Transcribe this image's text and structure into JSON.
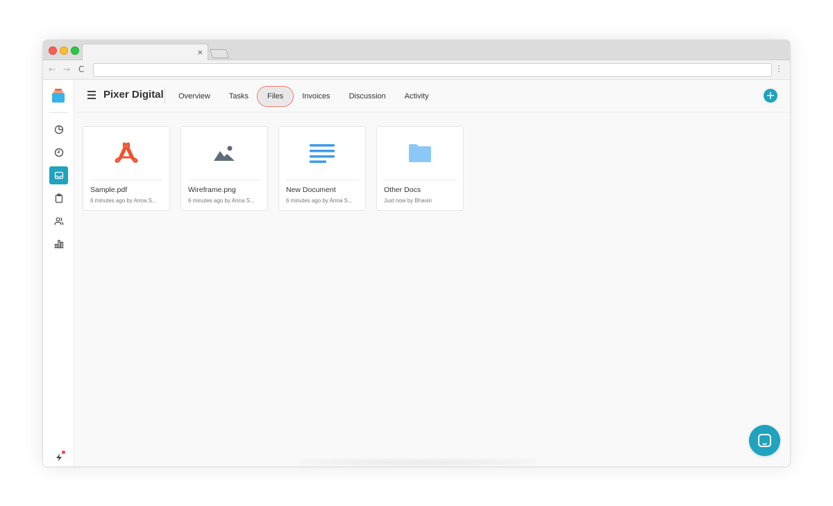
{
  "browser": {
    "tab_close_glyph": "×",
    "back_glyph": "←",
    "forward_glyph": "→",
    "reload_glyph": "C",
    "menu_glyph": "⋮",
    "url": ""
  },
  "header": {
    "brand": "Pixer Digital",
    "tabs": [
      {
        "label": "Overview",
        "active": false
      },
      {
        "label": "Tasks",
        "active": false
      },
      {
        "label": "Files",
        "active": true
      },
      {
        "label": "Invoices",
        "active": false
      },
      {
        "label": "Discussion",
        "active": false
      },
      {
        "label": "Activity",
        "active": false
      }
    ],
    "add_glyph": "+"
  },
  "sidebar": {
    "items": [
      {
        "icon": "pie-chart-icon",
        "active": false
      },
      {
        "icon": "clock-icon",
        "active": false
      },
      {
        "icon": "inbox-icon",
        "active": true
      },
      {
        "icon": "clipboard-icon",
        "active": false
      },
      {
        "icon": "users-icon",
        "active": false
      },
      {
        "icon": "bar-chart-icon",
        "active": false
      }
    ],
    "bottom": [
      {
        "icon": "lightning-icon",
        "has_notification": true
      },
      {
        "icon": "avatar"
      }
    ]
  },
  "files": [
    {
      "name": "Sample.pdf",
      "meta": "6 minutes ago by Anna S...",
      "icon": "pdf-icon",
      "color": "#f0522e"
    },
    {
      "name": "Wireframe.png",
      "meta": "6 minutes ago by Anna S...",
      "icon": "image-icon",
      "color": "#5f6b7a"
    },
    {
      "name": "New Document",
      "meta": "6 minutes ago by Anna S...",
      "icon": "document-icon",
      "color": "#3d9be9"
    },
    {
      "name": "Other Docs",
      "meta": "Just now by Bhavin",
      "icon": "folder-icon",
      "color": "#8cc8f7"
    }
  ],
  "colors": {
    "accent": "#1fa3be",
    "active_tab_outline": "#f06c5e"
  }
}
